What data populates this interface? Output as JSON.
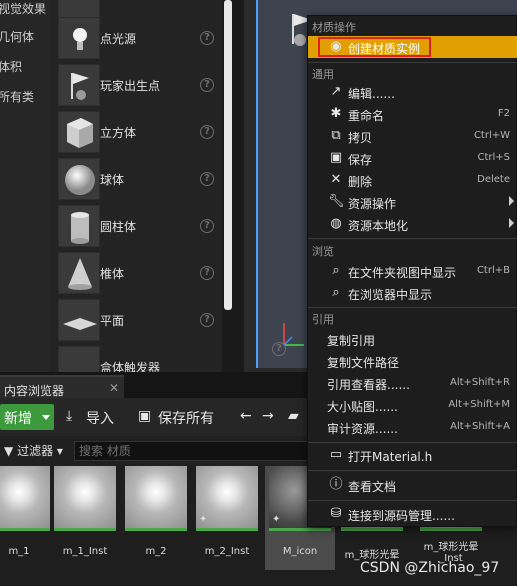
{
  "left_categories": [
    "视觉效果",
    "几何体",
    "体积",
    "所有类"
  ],
  "placement_items": [
    {
      "label": "",
      "icon": "cut-off-icon"
    },
    {
      "label": "点光源",
      "icon": "point-light-icon"
    },
    {
      "label": "玩家出生点",
      "icon": "player-start-icon"
    },
    {
      "label": "立方体",
      "icon": "cube-icon"
    },
    {
      "label": "球体",
      "icon": "sphere-icon"
    },
    {
      "label": "圆柱体",
      "icon": "cylinder-icon"
    },
    {
      "label": "椎体",
      "icon": "cone-icon"
    },
    {
      "label": "平面",
      "icon": "plane-icon"
    },
    {
      "label": "盒体触发器",
      "icon": "box-trigger-icon"
    }
  ],
  "context_menu": {
    "section_material": "材质操作",
    "create_instance": "创建材质实例",
    "section_common": "通用",
    "items_common": [
      {
        "label": "编辑......",
        "key": "",
        "icon": "edit-icon"
      },
      {
        "label": "重命名",
        "key": "F2",
        "icon": "rename-icon"
      },
      {
        "label": "拷贝",
        "key": "Ctrl+W",
        "icon": "copy-icon"
      },
      {
        "label": "保存",
        "key": "Ctrl+S",
        "icon": "save-icon"
      },
      {
        "label": "删除",
        "key": "Delete",
        "icon": "delete-icon"
      },
      {
        "label": "资源操作",
        "key": "",
        "icon": "wrench-icon",
        "submenu": true
      },
      {
        "label": "资源本地化",
        "key": "",
        "icon": "globe-icon",
        "submenu": true
      }
    ],
    "section_browse": "浏览",
    "items_browse": [
      {
        "label": "在文件夹视图中显示",
        "key": "Ctrl+B",
        "icon": "search-icon"
      },
      {
        "label": "在浏览器中显示",
        "key": "",
        "icon": "search-icon"
      }
    ],
    "section_ref": "引用",
    "items_ref": [
      {
        "label": "复制引用",
        "key": ""
      },
      {
        "label": "复制文件路径",
        "key": ""
      },
      {
        "label": "引用查看器......",
        "key": "Alt+Shift+R"
      },
      {
        "label": "大小贴图......",
        "key": "Alt+Shift+M"
      },
      {
        "label": "审计资源......",
        "key": "Alt+Shift+A"
      }
    ],
    "open_material_h": "打开Material.h",
    "view_docs": "查看文档",
    "connect_scc": "连接到源码管理......"
  },
  "content_browser": {
    "tab_label": "内容浏览器",
    "new_label": "新增",
    "import_label": "导入",
    "save_all_label": "保存所有",
    "filter_label": "过滤器",
    "search_placeholder": "搜索 材质",
    "assets": [
      "m_1",
      "m_1_Inst",
      "m_2",
      "m_2_Inst",
      "M_icon",
      "m_球形光晕",
      "m_球形光晕_Inst"
    ]
  },
  "watermark": "CSDN @Zhichao_97",
  "colors": {
    "accent": "#e0a000",
    "highlight_box": "#e21d1d",
    "new_button": "#3c9a3c"
  }
}
